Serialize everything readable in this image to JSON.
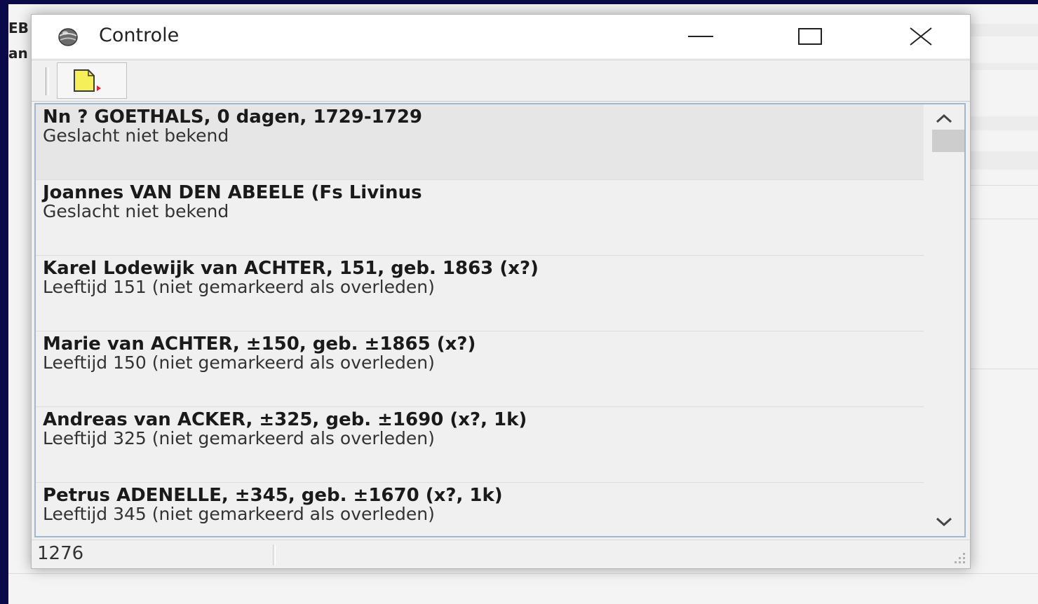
{
  "background_app": {
    "fragment_1": "EB",
    "fragment_2": "an"
  },
  "window": {
    "title": "Controle",
    "icon": "globe-icon",
    "controls": [
      "minimize-icon",
      "maximize-icon",
      "close-icon"
    ]
  },
  "toolbar": {
    "export_icon": "export-document-icon"
  },
  "list": {
    "items": [
      {
        "title": "Nn ? GOETHALS, 0 dagen, 1729-1729",
        "subtitle": "Geslacht niet bekend"
      },
      {
        "title": "Joannes VAN DEN ABEELE (Fs Livinus",
        "subtitle": "Geslacht niet bekend"
      },
      {
        "title": "Karel Lodewijk van ACHTER, 151, geb. 1863 (x?)",
        "subtitle": "Leeftijd 151 (niet gemarkeerd als overleden)"
      },
      {
        "title": "Marie van ACHTER, ±150, geb. ±1865 (x?)",
        "subtitle": "Leeftijd 150 (niet gemarkeerd als overleden)"
      },
      {
        "title": "Andreas van ACKER, ±325, geb. ±1690 (x?, 1k)",
        "subtitle": "Leeftijd 325 (niet gemarkeerd als overleden)"
      },
      {
        "title": "Petrus ADENELLE, ±345, geb. ±1670 (x?, 1k)",
        "subtitle": "Leeftijd 345 (niet gemarkeerd als overleden)"
      }
    ]
  },
  "statusbar": {
    "count": "1276"
  },
  "colors": {
    "desktop": "#0a0a4a",
    "window_bg": "#f0f0f0",
    "selected_row": "#e6e6e6",
    "list_border": "#9fb7d0",
    "export_icon_fill": "#f5ef5a",
    "export_icon_arrow": "#e0202a"
  }
}
